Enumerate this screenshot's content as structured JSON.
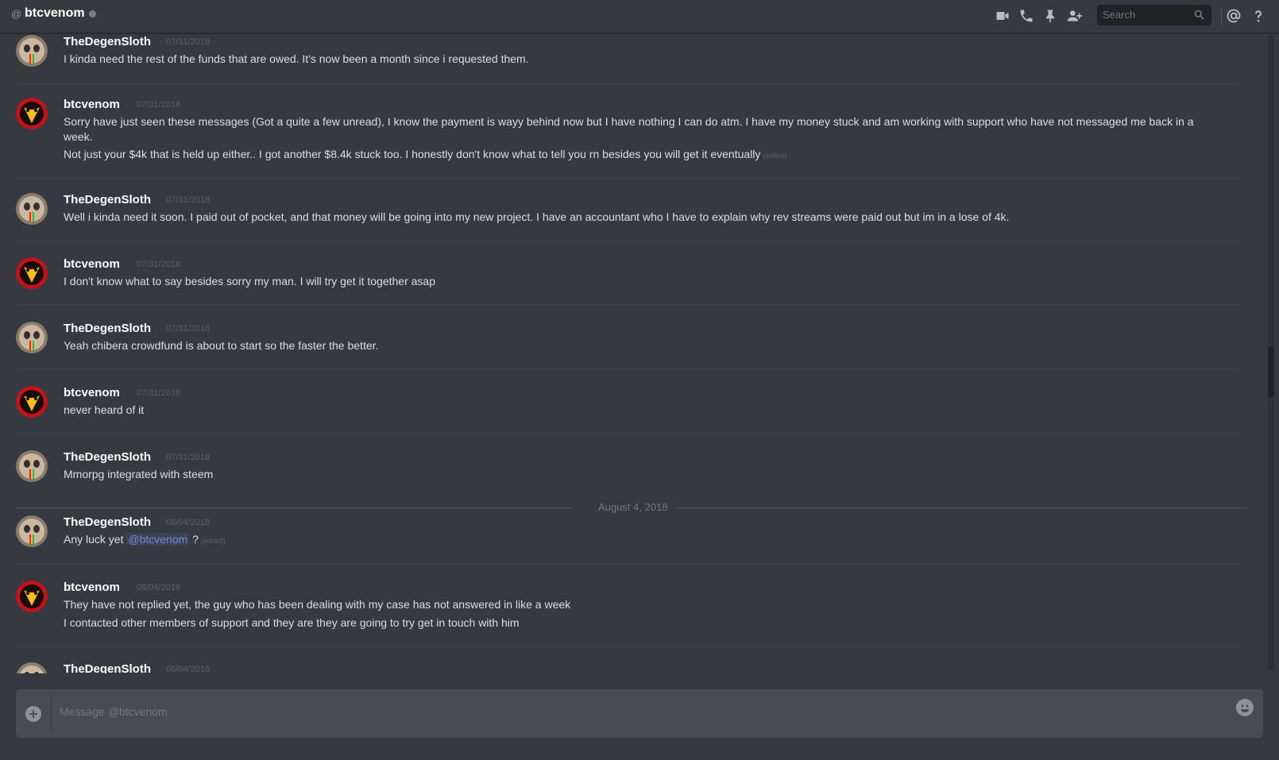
{
  "header": {
    "at_symbol": "@",
    "title": "btcvenom",
    "search_placeholder": "Search",
    "icons": [
      "video-call-icon",
      "phone-call-icon",
      "pin-icon",
      "add-friend-icon",
      "search-icon",
      "mentions-icon",
      "help-icon"
    ]
  },
  "messages": [
    {
      "user": "TheDegenSloth",
      "time": "07/31/2018",
      "lines": [
        "I kinda need the rest of the funds that are owed. It's now been a month since i requested them."
      ]
    },
    {
      "user": "btcvenom",
      "time": "07/31/2018",
      "lines": [
        "Sorry have just seen these messages (Got a quite a few unread), I know the payment is wayy behind now but I have nothing I can do atm. I have my money stuck and am working with support who have not messaged me back in a",
        "week.",
        "Not just your $4k that is held up either.. I got another $8.4k stuck too. I honestly don't know what to tell you rn besides you will get it eventually"
      ],
      "edited": "(edited)"
    },
    {
      "user": "TheDegenSloth",
      "time": "07/31/2018",
      "lines": [
        "Well i kinda need it soon. I paid out of pocket, and that money will be going into my new project. I have an accountant who I have to explain why rev streams were paid out but im in a lose of 4k."
      ]
    },
    {
      "user": "btcvenom",
      "time": "07/31/2018",
      "lines": [
        "I don't know what to say besides sorry my man. I will try get it together asap"
      ]
    },
    {
      "user": "TheDegenSloth",
      "time": "07/31/2018",
      "lines": [
        "Yeah chibera crowdfund is about to start so the faster the better."
      ]
    },
    {
      "user": "btcvenom",
      "time": "07/31/2018",
      "lines": [
        "never heard of it"
      ]
    },
    {
      "user": "TheDegenSloth",
      "time": "07/31/2018",
      "lines": [
        "Mmorpg integrated with  steem"
      ]
    },
    {
      "user": "TheDegenSloth",
      "time": "08/04/2018",
      "lines": [
        "Any luck yet "
      ],
      "mention": "@btcvenom",
      "after_mention": " ?",
      "edited": "(edited)"
    },
    {
      "user": "btcvenom",
      "time": "08/04/2018",
      "lines": [
        "They have not replied yet, the guy who has been dealing with my case has not answered in like a week",
        "I contacted other members of support and they are they are going to try get in touch with him"
      ]
    },
    {
      "user": "TheDegenSloth",
      "time": "08/04/2018",
      "lines": []
    }
  ],
  "date_divider": "August 4, 2018",
  "composer": {
    "placeholder": "Message @btcvenom"
  },
  "colors": {
    "background": "#36393f",
    "mention": "#7289da",
    "username": "#ffffff"
  }
}
